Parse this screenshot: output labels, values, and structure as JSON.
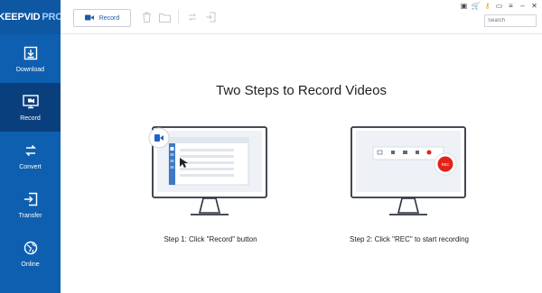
{
  "app": {
    "logo_main": "KEEPVID",
    "logo_pro": "PRO"
  },
  "sidebar": {
    "items": [
      {
        "label": "Download",
        "icon": "download-icon"
      },
      {
        "label": "Record",
        "icon": "record-screen-icon",
        "active": true
      },
      {
        "label": "Convert",
        "icon": "convert-icon"
      },
      {
        "label": "Transfer",
        "icon": "transfer-icon"
      },
      {
        "label": "Online",
        "icon": "globe-icon"
      }
    ]
  },
  "toolbar": {
    "record_label": "Record",
    "search_placeholder": "Search"
  },
  "main": {
    "title": "Two Steps to Record Videos",
    "steps": [
      {
        "caption": "Step 1: Click \"Record\" button"
      },
      {
        "caption": "Step 2: Click \"REC\" to start recording"
      }
    ],
    "rec_badge": "REC"
  },
  "colors": {
    "sidebar": "#0f5fb0",
    "sidebar_active": "#0a3f7d",
    "accent": "#1d5aa3",
    "rec_red": "#e2231a"
  }
}
